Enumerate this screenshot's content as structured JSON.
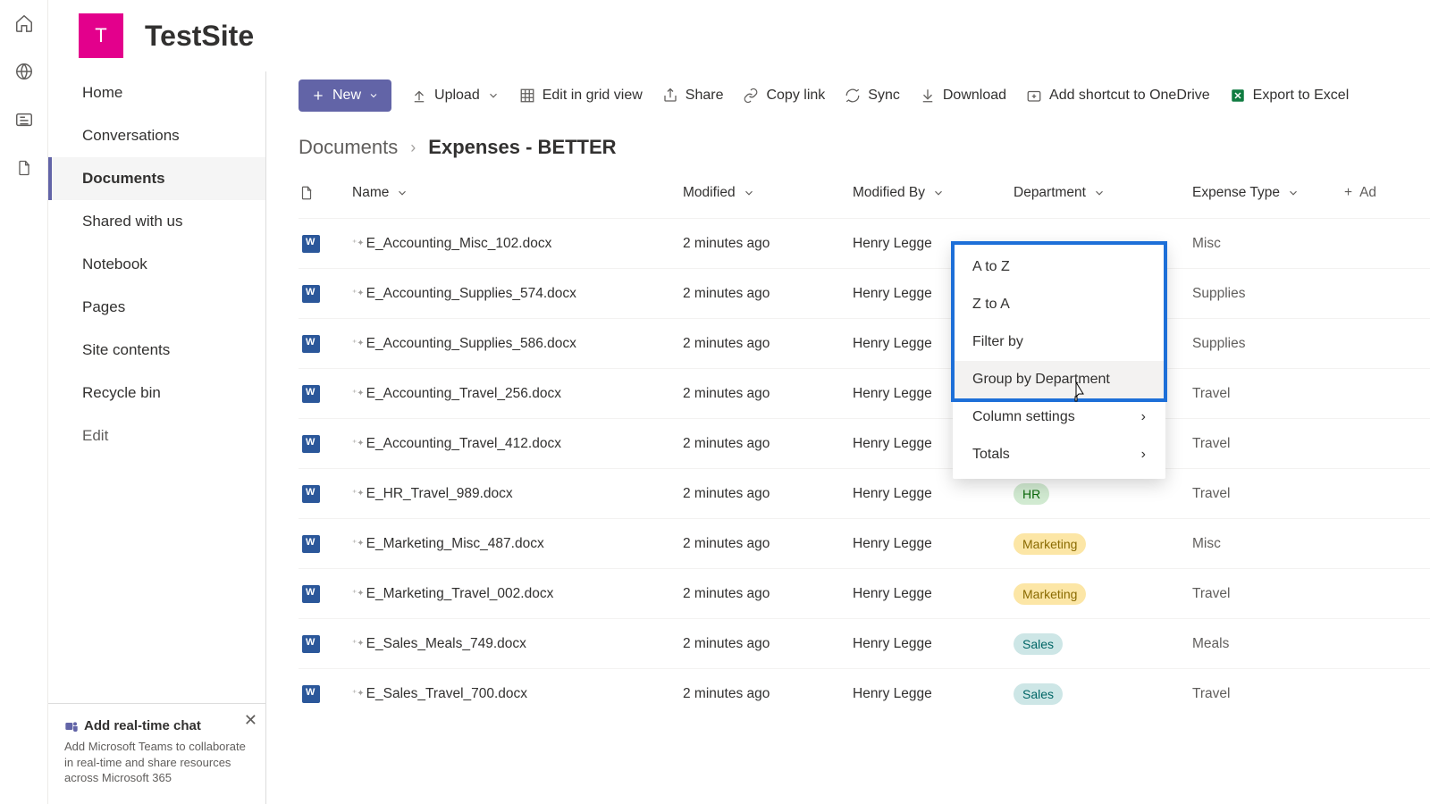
{
  "site": {
    "logo_letter": "T",
    "title": "TestSite"
  },
  "nav": {
    "items": [
      {
        "label": "Home"
      },
      {
        "label": "Conversations"
      },
      {
        "label": "Documents",
        "active": true
      },
      {
        "label": "Shared with us"
      },
      {
        "label": "Notebook"
      },
      {
        "label": "Pages"
      },
      {
        "label": "Site contents"
      },
      {
        "label": "Recycle bin"
      },
      {
        "label": "Edit",
        "edit": true
      }
    ]
  },
  "teams_promo": {
    "title": "Add real-time chat",
    "body": "Add Microsoft Teams to collaborate in real-time and share resources across Microsoft 365"
  },
  "cmdbar": {
    "new": "New",
    "upload": "Upload",
    "grid": "Edit in grid view",
    "share": "Share",
    "copylink": "Copy link",
    "sync": "Sync",
    "download": "Download",
    "shortcut": "Add shortcut to OneDrive",
    "export": "Export to Excel"
  },
  "breadcrumb": {
    "root": "Documents",
    "current": "Expenses - BETTER"
  },
  "columns": {
    "name": "Name",
    "modified": "Modified",
    "modifiedby": "Modified By",
    "department": "Department",
    "expensetype": "Expense Type",
    "add": "Ad"
  },
  "rows": [
    {
      "name": "E_Accounting_Misc_102.docx",
      "mod": "2 minutes ago",
      "by": "Henry Legge",
      "dept": "",
      "exp": "Misc"
    },
    {
      "name": "E_Accounting_Supplies_574.docx",
      "mod": "2 minutes ago",
      "by": "Henry Legge",
      "dept": "",
      "exp": "Supplies"
    },
    {
      "name": "E_Accounting_Supplies_586.docx",
      "mod": "2 minutes ago",
      "by": "Henry Legge",
      "dept": "",
      "exp": "Supplies"
    },
    {
      "name": "E_Accounting_Travel_256.docx",
      "mod": "2 minutes ago",
      "by": "Henry Legge",
      "dept": "",
      "exp": "Travel"
    },
    {
      "name": "E_Accounting_Travel_412.docx",
      "mod": "2 minutes ago",
      "by": "Henry Legge",
      "dept": "",
      "exp": "Travel"
    },
    {
      "name": "E_HR_Travel_989.docx",
      "mod": "2 minutes ago",
      "by": "Henry Legge",
      "dept": "HR",
      "exp": "Travel"
    },
    {
      "name": "E_Marketing_Misc_487.docx",
      "mod": "2 minutes ago",
      "by": "Henry Legge",
      "dept": "Marketing",
      "exp": "Misc"
    },
    {
      "name": "E_Marketing_Travel_002.docx",
      "mod": "2 minutes ago",
      "by": "Henry Legge",
      "dept": "Marketing",
      "exp": "Travel"
    },
    {
      "name": "E_Sales_Meals_749.docx",
      "mod": "2 minutes ago",
      "by": "Henry Legge",
      "dept": "Sales",
      "exp": "Meals"
    },
    {
      "name": "E_Sales_Travel_700.docx",
      "mod": "2 minutes ago",
      "by": "Henry Legge",
      "dept": "Sales",
      "exp": "Travel"
    }
  ],
  "colmenu": {
    "az": "A to Z",
    "za": "Z to A",
    "filter": "Filter by",
    "group": "Group by Department",
    "settings": "Column settings",
    "totals": "Totals"
  }
}
